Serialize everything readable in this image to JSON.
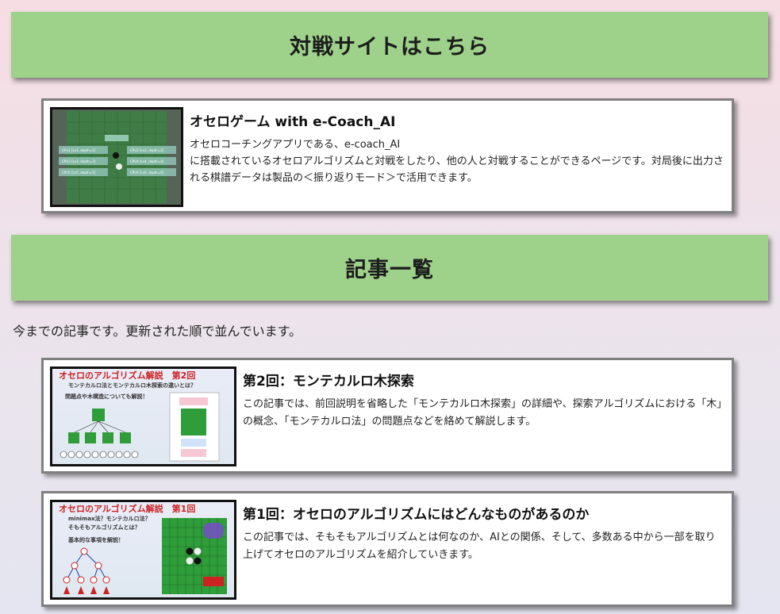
{
  "banners": {
    "battle": "対戦サイトはこちら",
    "articles": "記事一覧"
  },
  "battle_site": {
    "title": "オセロゲーム with e-Coach_AI",
    "description": "オセロコーチングアプリである、e-coach_AI\nに搭載されているオセロアルゴリズムと対戦をしたり、他の人と対戦することができるページです。対局後に出力される棋譜データは製品の＜振り返りモード＞で活用できます。",
    "thumb_labels": [
      "CPU1 [Lv1, depth=1]",
      "CPU2 [Lv2, depth=2]",
      "CPU3 [Lv3, depth=3]",
      "CPU4 [Lv4, depth=4]",
      "CPU5 [Lv5, depth=5]",
      "CPU6 [Lv6, depth=6]"
    ]
  },
  "intro_text": "今までの記事です。更新された順で並んでいます。",
  "articles": [
    {
      "title": "第2回：モンテカルロ木探索",
      "description": "この記事では、前回説明を省略した「モンテカルロ木探索」の詳細や、探索アルゴリズムにおける「木」の概念、「モンテカルロ法」の問題点などを絡めて解説します。",
      "thumb_title": "オセロのアルゴリズム解説　第2回",
      "thumb_sub1": "モンテカルロ法とモンテカルロ木探索の違いとは？",
      "thumb_sub2": "問題点や木構造についても解説！"
    },
    {
      "title": "第1回：オセロのアルゴリズムにはどんなものがあるのか",
      "description": "この記事では、そもそもアルゴリズムとは何なのか、AIとの関係、そして、多数ある中から一部を取り上げてオセロのアルゴリズムを紹介していきます。",
      "thumb_title": "オセロのアルゴリズム解説　第1回",
      "thumb_sub1": "minimax法？モンテカルロ法？",
      "thumb_sub2": "そもそもアルゴリズムとは？",
      "thumb_sub3": "基本的な事項を解説！"
    }
  ],
  "colors": {
    "banner": "#9ed18a",
    "board_green": "#2f9d3a",
    "thumb_title_red": "#cc2222"
  }
}
